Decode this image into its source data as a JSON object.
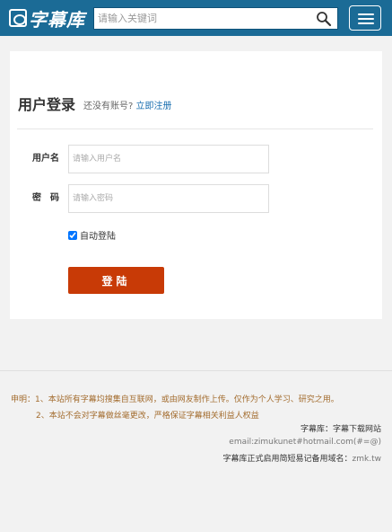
{
  "header": {
    "logo_text": "字幕库",
    "search_placeholder": "请输入关键词"
  },
  "login": {
    "title": "用户登录",
    "no_account": "还没有账号?",
    "register_link": "立即注册",
    "username_label": "用户名",
    "username_placeholder": "请输入用户名",
    "password_label": "密　码",
    "password_placeholder": "请输入密码",
    "remember_label": "自动登陆",
    "remember_checked": true,
    "submit_label": "登陆"
  },
  "footer": {
    "notice_line1": "申明：1、本站所有字幕均搜集自互联网，或由网友制作上传。仅作为个人学习、研究之用。",
    "notice_line2": "2、本站不会对字幕做丝毫更改，严格保证字幕相关利益人权益",
    "site_desc": "字幕库：字幕下载网站",
    "email": "email:zimukunet#hotmail.com(#=@)",
    "domain_label": "字幕库正式启用简短易记备用域名：",
    "domain_value": "zmk.tw"
  },
  "colors": {
    "header_bg": "#1b6b96",
    "login_button": "#c83a06",
    "link": "#1a6fb0",
    "notice_text": "#a36c2e"
  }
}
